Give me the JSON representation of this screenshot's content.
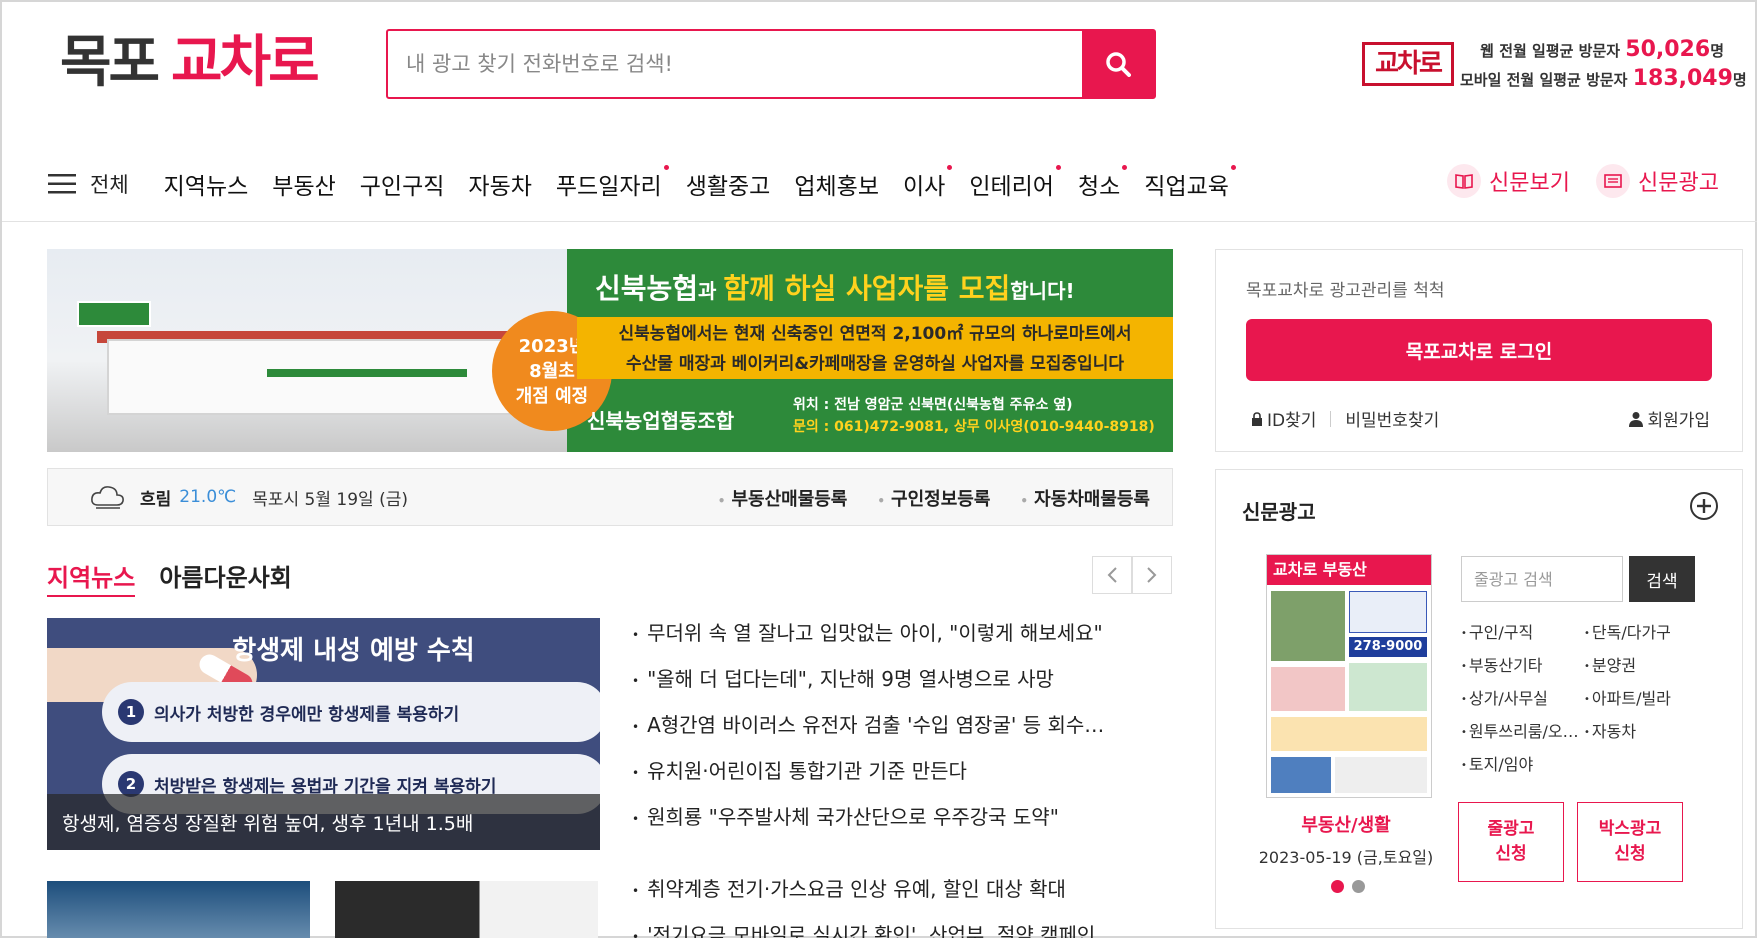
{
  "header": {
    "logo_part1": "목포",
    "logo_part2": "교차로",
    "search_placeholder": "내 광고 찾기 전화번호로 검색!",
    "visit_logo": "교차로",
    "web_visit_label": "웹 전월 일평균 방문자",
    "web_visit_count": "50,026",
    "mobile_visit_label": "모바일 전월 일평균 방문자",
    "mobile_visit_count": "183,049",
    "visit_unit": "명"
  },
  "nav": {
    "all_label": "전체",
    "items": [
      {
        "label": "지역뉴스",
        "dot": false
      },
      {
        "label": "부동산",
        "dot": false
      },
      {
        "label": "구인구직",
        "dot": false
      },
      {
        "label": "자동차",
        "dot": false
      },
      {
        "label": "푸드일자리",
        "dot": true
      },
      {
        "label": "생활중고",
        "dot": false
      },
      {
        "label": "업체홍보",
        "dot": false
      },
      {
        "label": "이사",
        "dot": true
      },
      {
        "label": "인테리어",
        "dot": true
      },
      {
        "label": "청소",
        "dot": true
      },
      {
        "label": "직업교육",
        "dot": true
      }
    ],
    "newspaper_view": "신문보기",
    "newspaper_ad": "신문광고"
  },
  "banner": {
    "circle_line1": "2023년",
    "circle_line2": "8월초",
    "circle_line3": "개점 예정",
    "head_org": "신북농협",
    "head_mid": "과 ",
    "head_highlight": "함께 하실 사업자를 모집",
    "head_end": "합니다!",
    "mid_line1": "신북농협에서는 현재 신축중인 연면적 2,100㎡ 규모의 하나로마트에서",
    "mid_line2": "수산물 매장과 베이커리&카페매장을 운영하실 사업자를 모집중입니다",
    "org_name": "신북농업협동조합",
    "info_line1": "위치 : 전남 영암군 신북면(신북농협 주유소 옆)",
    "info_line2": "문의 : 061)472-9081, 상무 이사영(010-9440-8918)"
  },
  "weather": {
    "condition": "흐림",
    "temp": "21.0℃",
    "date": "목포시 5월 19일 (금)",
    "links": [
      "부동산매물등록",
      "구인정보등록",
      "자동차매물등록"
    ]
  },
  "news": {
    "tabs": [
      "지역뉴스",
      "아름다운사회"
    ],
    "feature_title": "항생제 내성 예방 수칙",
    "feature_point1": "의사가 처방한 경우에만 항생제를 복용하기",
    "feature_point2": "처방받은 항생제는 용법과 기간을 지켜 복용하기",
    "feature_caption": "항생제, 염증성 장질환 위험 높여, 생후 1년내 1.5배",
    "headlines": [
      "무더위 속 열 잘나고 입맛없는 아이, \"이렇게 해보세요\"",
      "\"올해 더 덥다는데\", 지난해 9명 열사병으로 사망",
      "A형간염 바이러스 유전자 검출 '수입 염장굴' 등 회수…",
      "유치원·어린이집 통합기관 기준 만든다",
      "원희룡 \"우주발사체 국가산단으로 우주강국 도약\""
    ],
    "headlines2": [
      "취약계층 전기·가스요금 인상 유예, 할인 대상 확대",
      "'전기요금 모바일로 실시간 확인', 산업부, 절약 캠페인"
    ]
  },
  "login": {
    "desc": "목포교차로 광고관리를 척척",
    "button": "목포교차로 로그인",
    "find_id": "ID찾기",
    "find_pw": "비밀번호찾기",
    "join": "회원가입"
  },
  "ad": {
    "title": "신문광고",
    "paper_header": "교차로 부동산",
    "paper_phone": "278-9000",
    "paper_label": "부동산/생활",
    "paper_date": "2023-05-19 (금,토요일)",
    "search_placeholder": "줄광고 검색",
    "search_button": "검색",
    "categories": [
      "구인/구직",
      "단독/다가구",
      "부동산기타",
      "분양권",
      "상가/사무실",
      "아파트/빌라",
      "원투쓰리룸/오피스텔",
      "자동차",
      "토지/임야"
    ],
    "apply_line": "줄광고\n신청",
    "apply_box": "박스광고\n신청"
  },
  "colors": {
    "accent": "#e8174e",
    "banner_green": "#2d8a3a",
    "banner_yellow": "#f4b400",
    "banner_orange": "#f08a1e"
  }
}
